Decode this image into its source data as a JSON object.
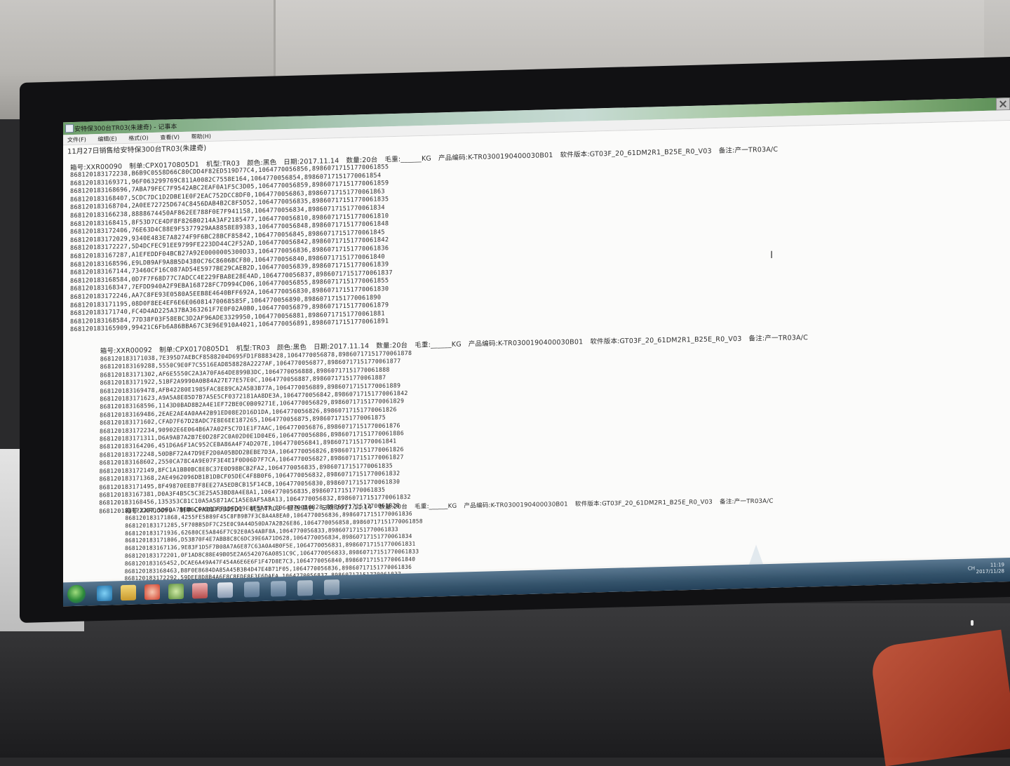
{
  "window": {
    "title": "安特保300台TR03(朱建奇) - 记事本",
    "menus": [
      "文件(F)",
      "编辑(E)",
      "格式(O)",
      "查看(V)",
      "帮助(H)"
    ]
  },
  "document": {
    "heading": "11月27日销售给安特保300台TR03(朱建奇)",
    "blocks": [
      {
        "header": [
          "箱号:XXR00090",
          "制单:CPX0170805D1",
          "机型:TR03",
          "颜色:黑色",
          "日期:2017.11.14",
          "数量:20台",
          "毛重:______KG",
          "产品编码:K-TR0300190400030B01",
          "软件版本:GT03F_20_61DM2R1_B25E_R0_V03",
          "备注:产一TR03A/C"
        ],
        "rows": [
          "868120183172238,B6B9C0558D66C80CDD4F82ED519D77C4,1064770056856,89860717151770061855",
          "868120183169371,96F063299769C811A0082C7558E164,1064770056854,89860717151770061854",
          "868120183168696,7ABA79FEC7F9542ABC2EAF0A1F5C3D05,1064770056859,89860717151770061859",
          "868120183168407,5CDC7DC1D2DBE1E0F2EAC752DCC8DF0,1064770056863,89860717151770061863",
          "868120183168704,2A0EE72725D674C8456DAB4B2C8F5D52,1064770056835,89860717151770061835",
          "868120183166238,8888674450AF862EE788F0E7F941158,1064770056834,89860717151770061834",
          "868120183168415,8F53D7CE4DF8F826B0214A3AF2185477,1064770056810,89860717151770061810",
          "868120183172406,76E63D4C88E9F5377929AA8858E89383,1064770056848,89860717151770061848",
          "868120183172029,9340E483E7A8274F9F6BC28BCF85842,1064770056845,89860717151770061845",
          "868120183172227,5D4DCFEC91EE9799FE223DD44C2F52AD,1064770056842,89860717151770061842",
          "868120183167287,A1EFEDDF04BCB27A92E0000005300D33,1064770056836,89860717151770061836",
          "868120183168596,E9LDB9AF9A8B5D4380C76C8606BCF80,1064770056840,89860717151770061840",
          "868120183167144,73460CF16C087AD54E5977BE29CAEB2D,1064770056839,89860717151770061839",
          "868120183168584,0D7F7F68D77C7ADCC4E229FBA8E28E4AD,1064770056837,89860717151770061837",
          "868120183168347,7EFDD940A2F9EBA168728FC7D994CD06,1064770056855,89860717151770061855",
          "868120183172246,AA7C8FE93E0580A5EEB8E4640BFF692A,1064770056830,89860717151770061830",
          "868120183171195,08D0F8EE4EF6E6E06081470068585F,1064770056890,89860717151770061890",
          "868120183171740,FC4D4AD225A37BA363261F7E0F02A0B0,1064770056879,89860717151770061879",
          "868120183168584,77D38F03F58EBC3D2AF96ADE3329950,1064770056881,89860717151770061881",
          "868120183165909,99421C6Fb6A86BBA67C3E96E910A4021,1064770056891,89860717151770061891"
        ]
      },
      {
        "header": [
          "箱号:XXR00092",
          "制单:CPX0170805D1",
          "机型:TR03",
          "颜色:黑色",
          "日期:2017.11.14",
          "数量:20台",
          "毛重:______KG",
          "产品编码:K-TR0300190400030B01",
          "软件版本:GT03F_20_61DM2R1_B25E_R0_V03",
          "备注:产一TR03A/C"
        ],
        "rows": [
          "868120183171038,7E395D7AEBCF8588204D695FD1F8883428,1064770056878,89860717151770061878",
          "868120183169288,5550C9E0F7C5516EAD858828A2227AF,1064770056877,89860717151770061877",
          "868120183171302,AF6E5550C2A3A70FA64DE899B3DC,1064770056888,89860717151770061888",
          "868120183171922,51BF2A9990A0B84A27E77E57E0C,1064770056887,89860717151770061887",
          "868120183169478,AFB42280E1985FAC8E89CA2A5B3B77A,1064770056889,89860717151770061889",
          "868120183171623,A9A5A8E85D7B7A5E5CF0372181AA8DE3A,1064770056842,89860717151770061842",
          "868120183168596,1143D0BAD8B2A4E1EF72BE0C0B09271E,1064770056829,89860717151770061829",
          "868120183169486,2EAE2AE4A0AA42B91ED08E2D16D1DA,1064770056826,89860717151770061826",
          "868120183171602,CFAD7F67D28ADC7E8E6EE187265,1064770056875,89860717151770061875",
          "868120183172234,90902E6E064B6A7A02F5C7D1E1F7AAC,1064770056876,89860717151770061876",
          "868120183171311,D6A9AB7A2B7E0D28F2C0A02D0E1D04E6,1064770056886,89860717151770061886",
          "868120183164206,451D6A6F1AC952CEBA86A4F74D207E,1064770056841,89860717151770061841",
          "868120183172248,50DBF72A47D9EF2D0A05BDD2BEBE7D3A,1064770056826,89860717151770061826",
          "868120183168602,2550CA78C4A9E07F3E4E1F0D06D7F7CA,1064770056827,89860717151770061827",
          "868120183172149,8FC1A1BB0BC8E8C37E0D98BCB2FA2,1064770056835,89860717151770061835",
          "868120183171368,2AE4962096DB1B1DBCF05DEC4F8B0F6,1064770056832,89860717151770061832",
          "868120183171495,8F49870EEB7F8EE27A5EDBCB15F14CB,1064770056830,89860717151770061830",
          "868120183167381,D0A3F4B5C5C3E25A53BD8A4E8A1,1064770056835,89860717151770061835",
          "868120183168456,135353C81C10A5A5871AC1A5E8AF5A8A13,1064770056832,89860717151770061832",
          "868120183172207,5DF9A79EB6C6AD8DFF1DFD09E8F5A87,1064770056828,89860717151770061828"
        ]
      },
      {
        "header": [
          "箱号:XXR00090",
          "制单:CPX0170805D1",
          "机型:TR03",
          "颜色:黑色",
          "日期:2017.11.14",
          "数量:20台",
          "毛重:______KG",
          "产品编码:K-TR0300190400030B01",
          "软件版本:GT03F_20_61DM2R1_B25E_R0_V03",
          "备注:产一TR03A/C"
        ],
        "rows": [
          "868120183171868,4255FE5B89F45C8FB9B7F3C8A4A8EA0,1064770056836,89860717151770061836",
          "868120183171285,5F70BB5DF7C25E0C9A44D50DA7A2B26E86,1064770056858,89860717151770061858",
          "868120183171936,62680CE5A846F7C92E0A54ABF8A,1064770056833,89860717151770061833",
          "868120183171806,D53B70F4E7ABB8C8C6DC39E6A71D628,1064770056834,89860717151770061834",
          "868120183167136,9E83F1D5F7B08A7A6E87C63A0A4B0F5E,1064770056831,89860717151770061831",
          "868120183172201,0F1AD8C88E49B05E2A6542076A0851C9C,1064770056833,89860717151770061833",
          "868120183165452,DCAE6A49A47F454A6E6E6F1F47D8E7C3,1064770056840,89860717151770061840",
          "868120183168463,B8F0E8684DA85A45B3B4D47E4B71F05,1064770056836,89860717151770061836",
          "868120183172292,59DEE8D8B4A6F8C8EDF8E3F6DAEA,1064770056837,89860717151770061837"
        ]
      }
    ]
  },
  "taskbar": {
    "tray_text": "CH",
    "clock_time": "11:19",
    "clock_date": "2017/11/28"
  }
}
